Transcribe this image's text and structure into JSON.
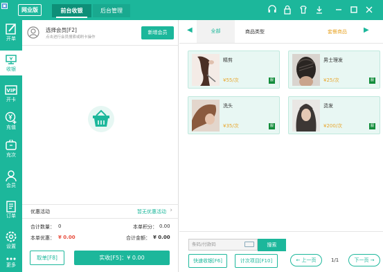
{
  "app": {
    "edition_badge": "网业版",
    "tabs": [
      "前台收银",
      "后台管理"
    ]
  },
  "sidebar": {
    "items": [
      {
        "label": "开单",
        "icon": "edit-icon"
      },
      {
        "label": "收银",
        "icon": "cashier-icon"
      },
      {
        "label": "开卡",
        "icon": "vip-card-icon"
      },
      {
        "label": "充值",
        "icon": "yen-plus-icon"
      },
      {
        "label": "充次",
        "icon": "ticket-icon"
      },
      {
        "label": "会员",
        "icon": "user-icon"
      },
      {
        "label": "订单",
        "icon": "order-list-icon"
      },
      {
        "label": "设置",
        "icon": "gear-icon"
      },
      {
        "label": "更多",
        "icon": "more-icon"
      }
    ]
  },
  "member": {
    "title": "选择会员[F2]",
    "subtitle": "点击进行会员搜索或刷卡操作",
    "new_button": "新增会员"
  },
  "promo": {
    "label": "优惠活动",
    "value": "暂无优惠活动"
  },
  "summary": {
    "count_label": "合计数量：",
    "count_value": "0",
    "points_label": "本单积分：",
    "points_value": "0.00",
    "discount_label": "本单优惠：",
    "discount_value": "¥ 0.00",
    "total_label": "合计金额：",
    "total_value": "¥ 0.00"
  },
  "actions": {
    "hang": "取单[F8]",
    "pay": "实收[F5]：¥ 0.00"
  },
  "categories": {
    "items": [
      "全部",
      "商品类型",
      "套餐商品"
    ],
    "active": "全部"
  },
  "products": [
    {
      "name": "精剪",
      "price": "¥55/次",
      "tag": "服"
    },
    {
      "name": "男士理发",
      "price": "¥25/次",
      "tag": "服"
    },
    {
      "name": "洗头",
      "price": "¥35/次",
      "tag": "服"
    },
    {
      "name": "烫发",
      "price": "¥200/次",
      "tag": "服"
    }
  ],
  "search": {
    "placeholder": "条码/付款码",
    "button": "搜索"
  },
  "bottom_buttons": {
    "quick_pay": "快速收银[F6]",
    "count_item": "计次项目[F10]",
    "prev": "上一页",
    "page": "1/1",
    "next": "下一页"
  },
  "colors": {
    "accent": "#1cb79b",
    "price": "#e8a62b",
    "red": "#e74c3c"
  }
}
